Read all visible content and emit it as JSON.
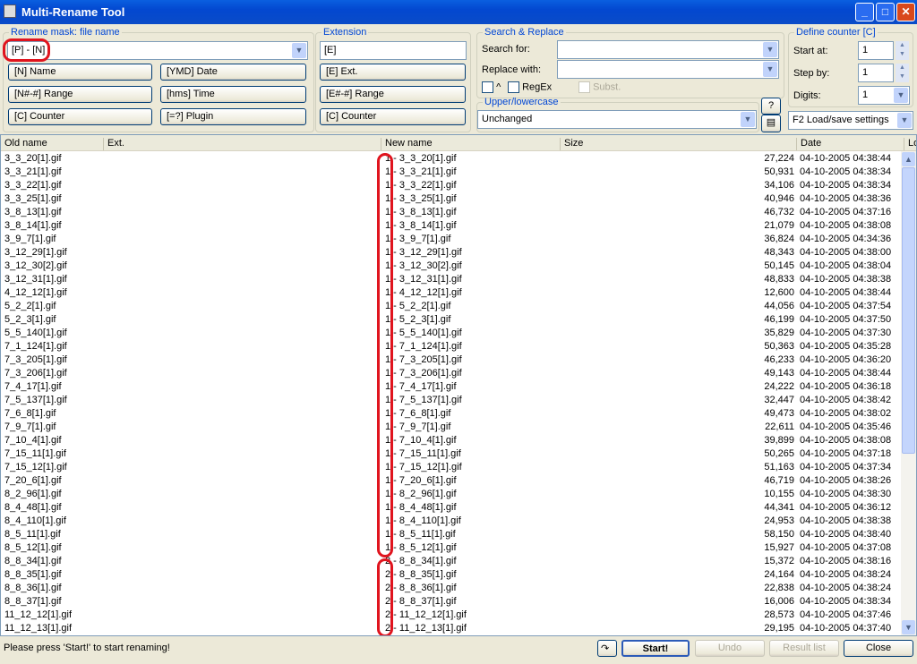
{
  "window": {
    "title": "Multi-Rename Tool",
    "min": "_",
    "max": "□",
    "close": "✕"
  },
  "mask": {
    "legend": "Rename mask: file name",
    "value": "[P] - [N]",
    "buttons": [
      "[N]  Name",
      "[YMD]  Date",
      "[N#-#]  Range",
      "[hms]  Time",
      "[C]  Counter",
      "[=?]  Plugin"
    ]
  },
  "extension": {
    "legend": "Extension",
    "value": "[E]",
    "buttons": [
      "[E]  Ext.",
      "[E#-#]  Range",
      "[C]  Counter"
    ]
  },
  "search": {
    "legend": "Search & Replace",
    "search_label": "Search for:",
    "search_value": "",
    "replace_label": "Replace with:",
    "replace_value": "",
    "caret_label": "^",
    "regex_label": "RegEx",
    "subst_label": "Subst."
  },
  "case": {
    "legend": "Upper/lowercase",
    "value": "Unchanged",
    "help": "?"
  },
  "counter": {
    "legend": "Define counter [C]",
    "start_label": "Start at:",
    "start": "1",
    "step_label": "Step by:",
    "step": "1",
    "digits_label": "Digits:",
    "digits": "1"
  },
  "settings": {
    "value": "F2 Load/save settings"
  },
  "columns": [
    "Old name",
    "Ext.",
    "New name",
    "Size",
    "Date",
    "Lo"
  ],
  "rows": [
    {
      "old": "3_3_20[1].gif",
      "new": "1 - 3_3_20[1].gif",
      "size": "27,224",
      "date": "04-10-2005 04:38:44"
    },
    {
      "old": "3_3_21[1].gif",
      "new": "1 - 3_3_21[1].gif",
      "size": "50,931",
      "date": "04-10-2005 04:38:34"
    },
    {
      "old": "3_3_22[1].gif",
      "new": "1 - 3_3_22[1].gif",
      "size": "34,106",
      "date": "04-10-2005 04:38:34"
    },
    {
      "old": "3_3_25[1].gif",
      "new": "1 - 3_3_25[1].gif",
      "size": "40,946",
      "date": "04-10-2005 04:38:36"
    },
    {
      "old": "3_8_13[1].gif",
      "new": "1 - 3_8_13[1].gif",
      "size": "46,732",
      "date": "04-10-2005 04:37:16"
    },
    {
      "old": "3_8_14[1].gif",
      "new": "1 - 3_8_14[1].gif",
      "size": "21,079",
      "date": "04-10-2005 04:38:08"
    },
    {
      "old": "3_9_7[1].gif",
      "new": "1 - 3_9_7[1].gif",
      "size": "36,824",
      "date": "04-10-2005 04:34:36"
    },
    {
      "old": "3_12_29[1].gif",
      "new": "1 - 3_12_29[1].gif",
      "size": "48,343",
      "date": "04-10-2005 04:38:00"
    },
    {
      "old": "3_12_30[2].gif",
      "new": "1 - 3_12_30[2].gif",
      "size": "50,145",
      "date": "04-10-2005 04:38:04"
    },
    {
      "old": "3_12_31[1].gif",
      "new": "1 - 3_12_31[1].gif",
      "size": "48,833",
      "date": "04-10-2005 04:38:38"
    },
    {
      "old": "4_12_12[1].gif",
      "new": "1 - 4_12_12[1].gif",
      "size": "12,600",
      "date": "04-10-2005 04:38:44"
    },
    {
      "old": "5_2_2[1].gif",
      "new": "1 - 5_2_2[1].gif",
      "size": "44,056",
      "date": "04-10-2005 04:37:54"
    },
    {
      "old": "5_2_3[1].gif",
      "new": "1 - 5_2_3[1].gif",
      "size": "46,199",
      "date": "04-10-2005 04:37:50"
    },
    {
      "old": "5_5_140[1].gif",
      "new": "1 - 5_5_140[1].gif",
      "size": "35,829",
      "date": "04-10-2005 04:37:30"
    },
    {
      "old": "7_1_124[1].gif",
      "new": "1 - 7_1_124[1].gif",
      "size": "50,363",
      "date": "04-10-2005 04:35:28"
    },
    {
      "old": "7_3_205[1].gif",
      "new": "1 - 7_3_205[1].gif",
      "size": "46,233",
      "date": "04-10-2005 04:36:20"
    },
    {
      "old": "7_3_206[1].gif",
      "new": "1 - 7_3_206[1].gif",
      "size": "49,143",
      "date": "04-10-2005 04:38:44"
    },
    {
      "old": "7_4_17[1].gif",
      "new": "1 - 7_4_17[1].gif",
      "size": "24,222",
      "date": "04-10-2005 04:36:18"
    },
    {
      "old": "7_5_137[1].gif",
      "new": "1 - 7_5_137[1].gif",
      "size": "32,447",
      "date": "04-10-2005 04:38:42"
    },
    {
      "old": "7_6_8[1].gif",
      "new": "1 - 7_6_8[1].gif",
      "size": "49,473",
      "date": "04-10-2005 04:38:02"
    },
    {
      "old": "7_9_7[1].gif",
      "new": "1 - 7_9_7[1].gif",
      "size": "22,611",
      "date": "04-10-2005 04:35:46"
    },
    {
      "old": "7_10_4[1].gif",
      "new": "1 - 7_10_4[1].gif",
      "size": "39,899",
      "date": "04-10-2005 04:38:08"
    },
    {
      "old": "7_15_11[1].gif",
      "new": "1 - 7_15_11[1].gif",
      "size": "50,265",
      "date": "04-10-2005 04:37:18"
    },
    {
      "old": "7_15_12[1].gif",
      "new": "1 - 7_15_12[1].gif",
      "size": "51,163",
      "date": "04-10-2005 04:37:34"
    },
    {
      "old": "7_20_6[1].gif",
      "new": "1 - 7_20_6[1].gif",
      "size": "46,719",
      "date": "04-10-2005 04:38:26"
    },
    {
      "old": "8_2_96[1].gif",
      "new": "1 - 8_2_96[1].gif",
      "size": "10,155",
      "date": "04-10-2005 04:38:30"
    },
    {
      "old": "8_4_48[1].gif",
      "new": "1 - 8_4_48[1].gif",
      "size": "44,341",
      "date": "04-10-2005 04:36:12"
    },
    {
      "old": "8_4_110[1].gif",
      "new": "1 - 8_4_110[1].gif",
      "size": "24,953",
      "date": "04-10-2005 04:38:38"
    },
    {
      "old": "8_5_11[1].gif",
      "new": "1 - 8_5_11[1].gif",
      "size": "58,150",
      "date": "04-10-2005 04:38:40"
    },
    {
      "old": "8_5_12[1].gif",
      "new": "1 - 8_5_12[1].gif",
      "size": "15,927",
      "date": "04-10-2005 04:37:08"
    },
    {
      "old": "8_8_34[1].gif",
      "new": "2 - 8_8_34[1].gif",
      "size": "15,372",
      "date": "04-10-2005 04:38:16"
    },
    {
      "old": "8_8_35[1].gif",
      "new": "2 - 8_8_35[1].gif",
      "size": "24,164",
      "date": "04-10-2005 04:38:24"
    },
    {
      "old": "8_8_36[1].gif",
      "new": "2 - 8_8_36[1].gif",
      "size": "22,838",
      "date": "04-10-2005 04:38:24"
    },
    {
      "old": "8_8_37[1].gif",
      "new": "2 - 8_8_37[1].gif",
      "size": "16,006",
      "date": "04-10-2005 04:38:34"
    },
    {
      "old": "11_12_12[1].gif",
      "new": "2 - 11_12_12[1].gif",
      "size": "28,573",
      "date": "04-10-2005 04:37:46"
    },
    {
      "old": "11_12_13[1].gif",
      "new": "2 - 11_12_13[1].gif",
      "size": "29,195",
      "date": "04-10-2005 04:37:40"
    }
  ],
  "status": {
    "message": "Please press 'Start!' to start renaming!",
    "start": "Start!",
    "undo": "Undo",
    "result": "Result list",
    "close": "Close"
  },
  "colors": {
    "accent": "#0046d5",
    "highlight": "#e0141e"
  }
}
